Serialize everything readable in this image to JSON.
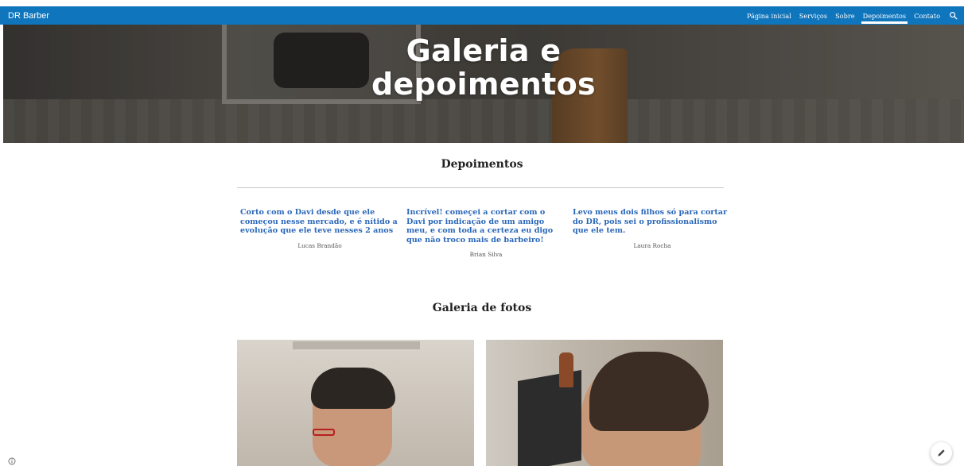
{
  "header": {
    "brand": "DR Barber",
    "nav": [
      {
        "label": "Página inicial",
        "active": false
      },
      {
        "label": "Serviços",
        "active": false
      },
      {
        "label": "Sobre",
        "active": false
      },
      {
        "label": "Depoimentos",
        "active": true
      },
      {
        "label": "Contato",
        "active": false
      }
    ],
    "search_icon": "search-icon"
  },
  "hero": {
    "title_line1": "Galeria e",
    "title_line2": "depoimentos"
  },
  "testimonials": {
    "title": "Depoimentos",
    "items": [
      {
        "quote": "Corto com o Davi desde que ele começou nesse mercado, e é nítido a evolução que ele teve nesses 2 anos",
        "author": "Lucas Brandão"
      },
      {
        "quote": "Incrível! começei a cortar com o Davi por indicação de um amigo meu, e com toda a certeza eu digo que não troco mais de barbeiro!",
        "author": "Brian Silva"
      },
      {
        "quote": "Levo meus dois filhos só para cortar do DR, pois sei o profissionalismo que ele tem.",
        "author": "Laura Rocha"
      }
    ]
  },
  "gallery": {
    "title": "Galeria de fotos"
  },
  "colors": {
    "nav_bg": "#0f75bc",
    "quote": "#2a67b9"
  },
  "icons": {
    "info": "info-icon",
    "edit": "pencil-icon"
  }
}
